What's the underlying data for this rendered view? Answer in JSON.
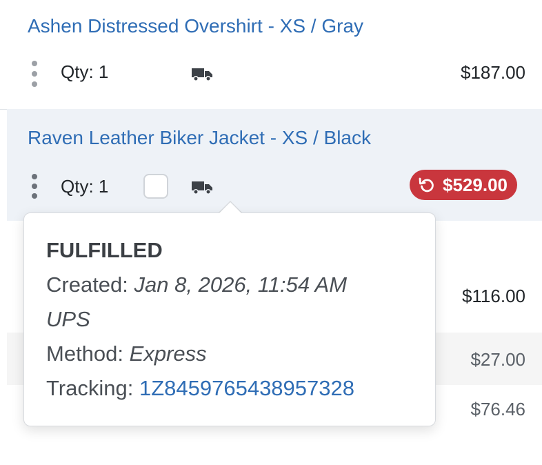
{
  "items": [
    {
      "product": "Ashen Distressed Overshirt - XS / Gray",
      "qty_label": "Qty: 1",
      "price": "$187.00"
    },
    {
      "product": "Raven Leather Biker Jacket - XS / Black",
      "qty_label": "Qty: 1",
      "price": "$529.00",
      "refunded": true
    },
    {
      "price": "$116.00"
    }
  ],
  "summary": {
    "line_1_amount": "$27.00",
    "line_2_amount": "$76.46"
  },
  "fulfillment_popover": {
    "status": "FULFILLED",
    "created_label": "Created:",
    "created_value": "Jan 8, 2026, 11:54 AM",
    "carrier": "UPS",
    "method_label": "Method:",
    "method_value": "Express",
    "tracking_label": "Tracking:",
    "tracking_number": "1Z8459765438957328"
  },
  "icons": {
    "truck": "truck-icon",
    "kebab": "kebab-menu-icon",
    "refund": "refund-icon"
  },
  "colors": {
    "link": "#2f6db5",
    "refund_badge": "#c9363d",
    "selected_row": "#eef2f7"
  }
}
